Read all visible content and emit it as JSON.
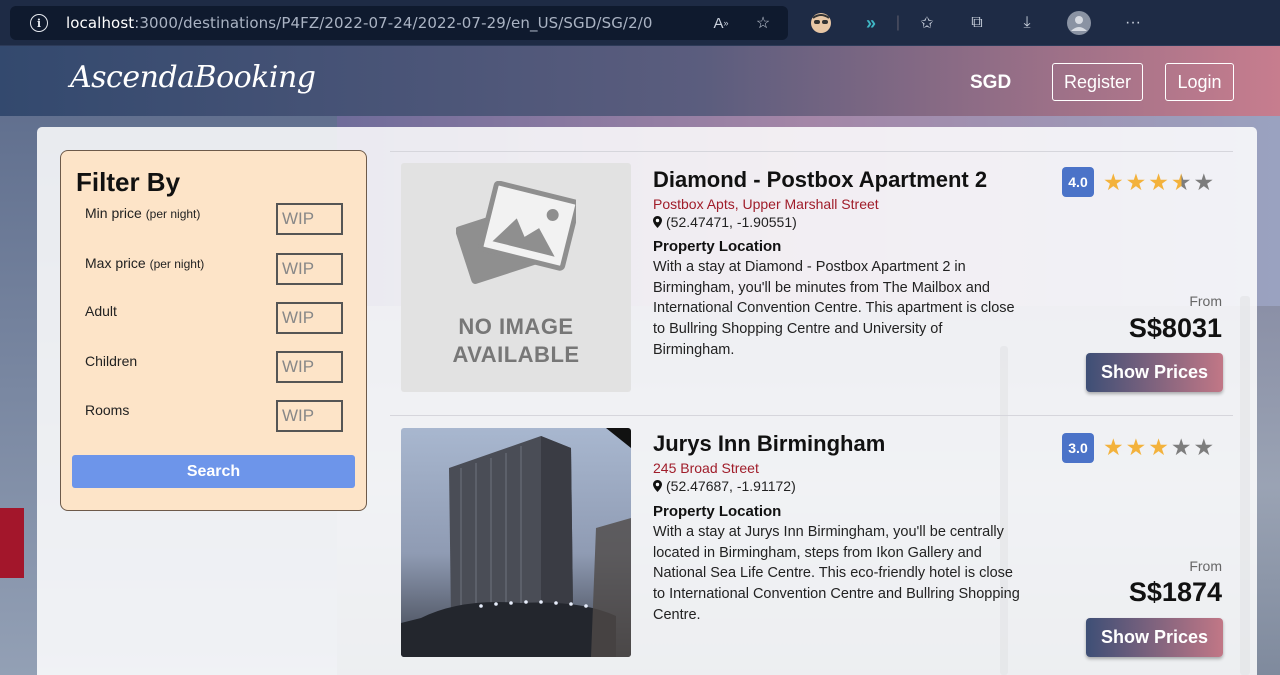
{
  "browser": {
    "url_host": "localhost",
    "url_path": ":3000/destinations/P4FZ/2022-07-24/2022-07-29/en_US/SGD/SG/2/0"
  },
  "header": {
    "logo": "AscendaBooking",
    "currency": "SGD",
    "register_label": "Register",
    "login_label": "Login"
  },
  "filter": {
    "title": "Filter By",
    "fields": [
      {
        "label": "Min price",
        "sub": "(per night)",
        "value": "WIP"
      },
      {
        "label": "Max price",
        "sub": "(per night)",
        "value": "WIP"
      },
      {
        "label": "Adult",
        "sub": "",
        "value": "WIP"
      },
      {
        "label": "Children",
        "sub": "",
        "value": "WIP"
      },
      {
        "label": "Rooms",
        "sub": "",
        "value": "WIP"
      }
    ],
    "search_label": "Search"
  },
  "hotels": [
    {
      "name": "Diamond - Postbox Apartment 2",
      "address": "Postbox Apts, Upper Marshall Street",
      "coords": "(52.47471, -1.90551)",
      "location_title": "Property Location",
      "description": "With a stay at Diamond - Postbox Apartment 2 in Birmingham, you'll be minutes from The Mailbox and International Convention Centre. This apartment is close to Bullring Shopping Centre and University of Birmingham.",
      "rating": "4.0",
      "stars": 3.5,
      "from_label": "From",
      "price": "S$8031",
      "button_label": "Show Prices",
      "image_text_1": "NO IMAGE",
      "image_text_2": "AVAILABLE"
    },
    {
      "name": "Jurys Inn Birmingham",
      "address": "245 Broad Street",
      "coords": "(52.47687, -1.91172)",
      "location_title": "Property Location",
      "description": "With a stay at Jurys Inn Birmingham, you'll be centrally located in Birmingham, steps from Ikon Gallery and National Sea Life Centre. This eco-friendly hotel is close to International Convention Centre and Bullring Shopping Centre.",
      "rating": "3.0",
      "stars": 3,
      "from_label": "From",
      "price": "S$1874",
      "button_label": "Show Prices"
    }
  ],
  "colors": {
    "accent_blue": "#6d95ea",
    "rating_badge": "#4b73c8",
    "address_red": "#a01d2a",
    "star_gold": "#f3b23c"
  }
}
